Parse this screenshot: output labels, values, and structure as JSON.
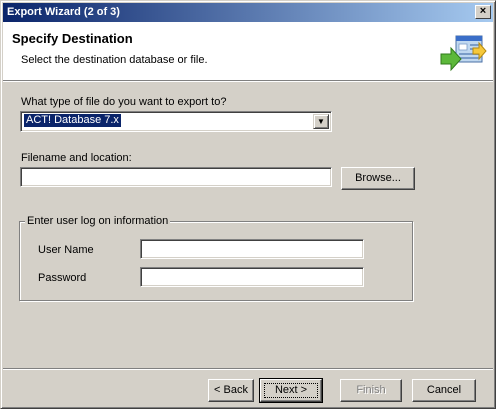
{
  "window": {
    "title": "Export Wizard (2 of 3)",
    "close_label": "×"
  },
  "header": {
    "title": "Specify Destination",
    "subtitle": "Select the destination database or file."
  },
  "file_type": {
    "label": "What type of file do you want to export to?",
    "selected": "ACT! Database 7.x",
    "arrow": "▼"
  },
  "filename": {
    "label": "Filename and location:",
    "value": "",
    "browse_label": "Browse..."
  },
  "logon": {
    "group_label": "Enter user log on information",
    "username_label": "User Name",
    "username_value": "",
    "password_label": "Password",
    "password_value": ""
  },
  "buttons": {
    "back": "< Back",
    "next": "Next >",
    "finish": "Finish",
    "cancel": "Cancel"
  },
  "icons": {
    "header": "export-wizard-icon"
  },
  "colors": {
    "titlebar_start": "#0a246a",
    "titlebar_end": "#a6caf0",
    "face": "#d4d0c8"
  }
}
